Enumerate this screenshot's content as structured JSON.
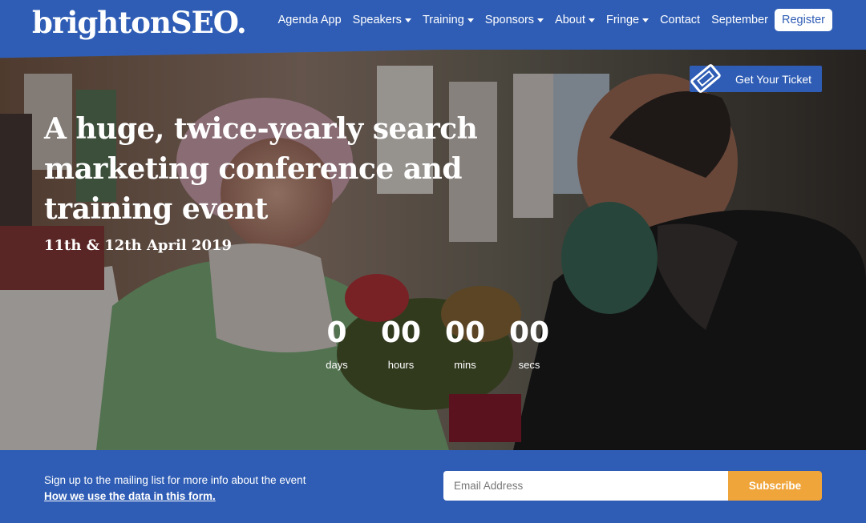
{
  "header": {
    "logo": "brightonSEO.",
    "nav": [
      {
        "label": "Agenda App",
        "dropdown": false
      },
      {
        "label": "Speakers",
        "dropdown": true
      },
      {
        "label": "Training",
        "dropdown": true
      },
      {
        "label": "Sponsors",
        "dropdown": true
      },
      {
        "label": "About",
        "dropdown": true
      },
      {
        "label": "Fringe",
        "dropdown": true
      },
      {
        "label": "Contact",
        "dropdown": false
      },
      {
        "label": "September",
        "dropdown": false
      }
    ],
    "register_label": "Register"
  },
  "hero": {
    "ticket_label": "Get Your Ticket",
    "headline": "A huge, twice-yearly search marketing conference and training event",
    "date": "11th & 12th April 2019",
    "countdown": [
      {
        "value": "0",
        "label": "days"
      },
      {
        "value": "00",
        "label": "hours"
      },
      {
        "value": "00",
        "label": "mins"
      },
      {
        "value": "00",
        "label": "secs"
      }
    ]
  },
  "mailing": {
    "text": "Sign up to the mailing list for more info about the event",
    "link": "How we use the data in this form.",
    "email_placeholder": "Email Address",
    "subscribe_label": "Subscribe"
  },
  "colors": {
    "brand_blue": "#2f5db5",
    "accent_orange": "#f0a53a"
  },
  "icons": {
    "ticket": "ticket-icon",
    "dropdown": "caret-down-icon"
  }
}
